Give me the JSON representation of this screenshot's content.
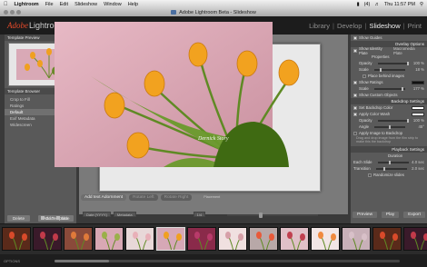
{
  "menubar": {
    "app": "Lightroom",
    "items": [
      "File",
      "Edit",
      "Slideshow",
      "Window",
      "Help"
    ],
    "clock": "Thu 11:57 PM",
    "battery": "(4)"
  },
  "window": {
    "title": "Adobe Lightroom Beta - Slideshow"
  },
  "identity": {
    "brand_adobe": "Adobe",
    "brand_name": "Lightroom",
    "modules": [
      "Library",
      "Develop",
      "Slideshow",
      "Print"
    ],
    "active_module": "Slideshow"
  },
  "left_panel": {
    "preview_title": "Template Preview",
    "browser_title": "Template Browser",
    "templates": [
      "Crop to Fill",
      "Ratings",
      "Default",
      "Exif Metadata",
      "Widescreen"
    ],
    "selected_template": "Default",
    "delete_label": "Delete",
    "add_label": "Add Template"
  },
  "slide": {
    "signature": "Dernick Story"
  },
  "toolbar": {
    "add_text_label": "Add text Adornment",
    "rotate_left_label": "Rotate Left",
    "rotate_right_label": "Rotate Right",
    "placement_label": "Placement"
  },
  "info_bar": {
    "date_field": "Date (YYYY)",
    "metadata_field": "Metadata",
    "count_field": "1/4"
  },
  "view": {
    "grid_label": "Grid",
    "slide_label": "Slide"
  },
  "right_panel": {
    "options_title": "Overlay Options",
    "show_guides": "Show Guides",
    "show_identity": "Show Identity Plate",
    "identity_value": "Macromedia Plate",
    "properties": "Properties",
    "opacity_label": "Opacity",
    "opacity_value": "100 %",
    "scale_label": "Scale",
    "scale_value": "18 %",
    "place_behind": "Place behind images",
    "show_ratings": "Show Ratings",
    "ratings_scale_value": "177 %",
    "show_custom": "Show Custom Objects",
    "backdrop_title": "Backdrop Settings",
    "set_backdrop": "Set Backdrop Color",
    "apply_wash": "Apply Color Wash",
    "wash_opacity_label": "Opacity",
    "wash_opacity_value": "100 %",
    "angle_label": "Angle",
    "angle_value": "45°",
    "apply_image": "Apply Image to Backdrop",
    "image_note": "Drag and drop image from the film strip to make this the backdrop",
    "playback_title": "Playback Settings",
    "duration_label": "Duration",
    "each_slide_label": "Each Slide",
    "each_slide_value": "4.0 sec",
    "transition_label": "Transition",
    "transition_value": "2.0 sec",
    "randomize_label": "Randomize slides",
    "preview_label": "Preview",
    "play_label": "Play",
    "export_label": "Export"
  },
  "status": {
    "options": "OPTIONS"
  },
  "colors": {
    "accent_red": "#e54a2a",
    "panel_gray": "#595959",
    "photo_pink": "#d6a8b6",
    "tulip_orange": "#f0a020"
  }
}
